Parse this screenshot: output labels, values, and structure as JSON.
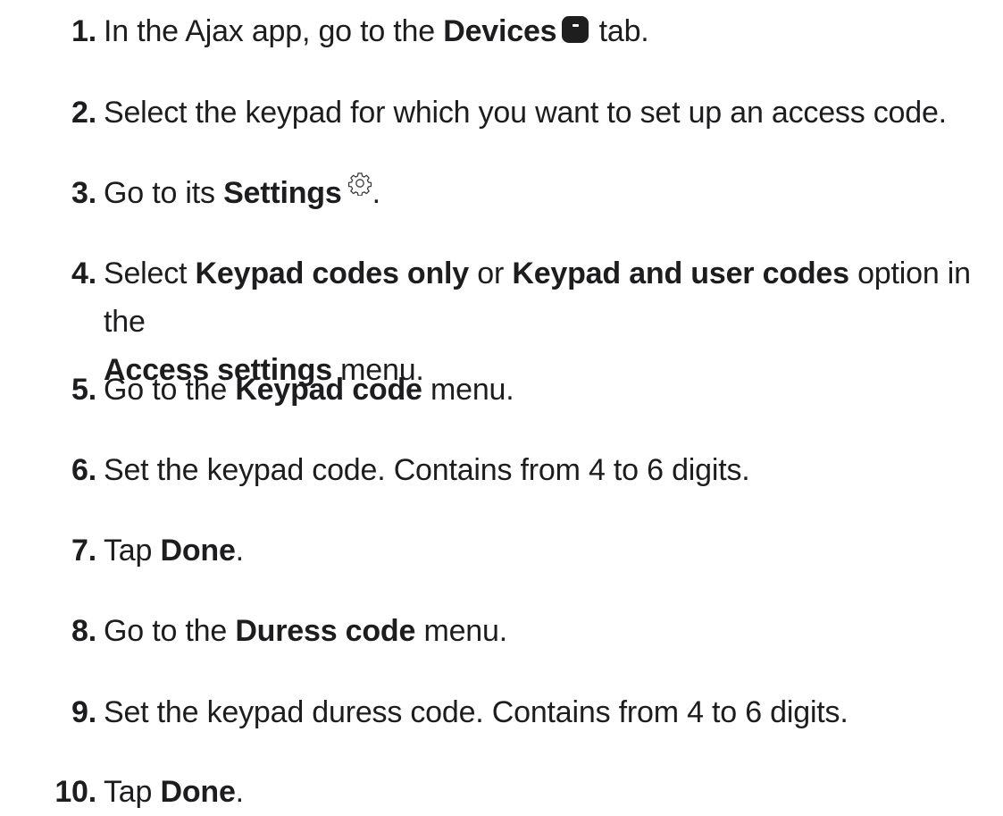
{
  "steps": [
    {
      "num": "1.",
      "parts": [
        {
          "t": "In the Ajax app, go to the "
        },
        {
          "b": "Devices"
        },
        {
          "icon": "devices-icon"
        },
        {
          "t": " tab."
        }
      ]
    },
    {
      "num": "2.",
      "parts": [
        {
          "t": "Select the keypad for which you want to set up an access code."
        }
      ]
    },
    {
      "num": "3.",
      "parts": [
        {
          "t": "Go to its "
        },
        {
          "b": "Settings"
        },
        {
          "icon": "gear-icon"
        },
        {
          "t": "."
        }
      ]
    },
    {
      "num": "4.",
      "lines": [
        [
          {
            "t": "Select "
          },
          {
            "b": "Keypad codes only"
          },
          {
            "t": " or "
          },
          {
            "b": "Keypad and user codes"
          },
          {
            "t": " option in the"
          }
        ],
        [
          {
            "b": "Access settings"
          },
          {
            "t": " menu."
          }
        ]
      ]
    },
    {
      "num": "5.",
      "parts": [
        {
          "t": "Go to the "
        },
        {
          "b": "Keypad code"
        },
        {
          "t": " menu."
        }
      ]
    },
    {
      "num": "6.",
      "parts": [
        {
          "t": "Set the keypad code. Contains from 4 to 6 digits."
        }
      ]
    },
    {
      "num": "7.",
      "parts": [
        {
          "t": "Tap "
        },
        {
          "b": "Done"
        },
        {
          "t": "."
        }
      ]
    },
    {
      "num": "8.",
      "parts": [
        {
          "t": "Go to the "
        },
        {
          "b": "Duress code"
        },
        {
          "t": " menu."
        }
      ]
    },
    {
      "num": "9.",
      "parts": [
        {
          "t": "Set the keypad duress code. Contains from 4 to 6 digits."
        }
      ]
    },
    {
      "num": "10.",
      "parts": [
        {
          "t": "Tap "
        },
        {
          "b": "Done"
        },
        {
          "t": "."
        }
      ]
    }
  ]
}
